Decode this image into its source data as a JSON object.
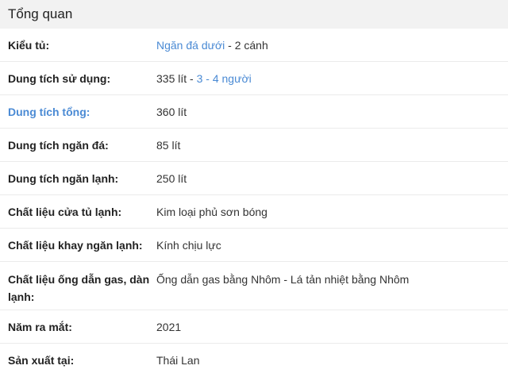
{
  "section": {
    "title": "Tổng quan"
  },
  "rows": [
    {
      "label": "Kiểu tủ:",
      "value_link": "Ngăn đá dưới",
      "value_rest": " - 2 cánh"
    },
    {
      "label": "Dung tích sử dụng:",
      "value_pre": "335 lít - ",
      "value_link": "3 - 4 người"
    },
    {
      "label": "Dung tích tổng:",
      "value": "360 lít"
    },
    {
      "label": "Dung tích ngăn đá:",
      "value": "85 lít"
    },
    {
      "label": "Dung tích ngăn lạnh:",
      "value": "250 lít"
    },
    {
      "label": "Chất liệu cửa tủ lạnh:",
      "value": "Kim loại phủ sơn bóng"
    },
    {
      "label": "Chất liệu khay ngăn lạnh:",
      "value": "Kính chịu lực"
    },
    {
      "label": "Chất liệu ống dẫn gas, dàn lạnh:",
      "value": "Ống dẫn gas bằng Nhôm - Lá tản nhiệt bằng Nhôm"
    },
    {
      "label": "Năm ra mắt:",
      "value": "2021"
    },
    {
      "label": "Sản xuất tại:",
      "value": "Thái Lan"
    }
  ]
}
